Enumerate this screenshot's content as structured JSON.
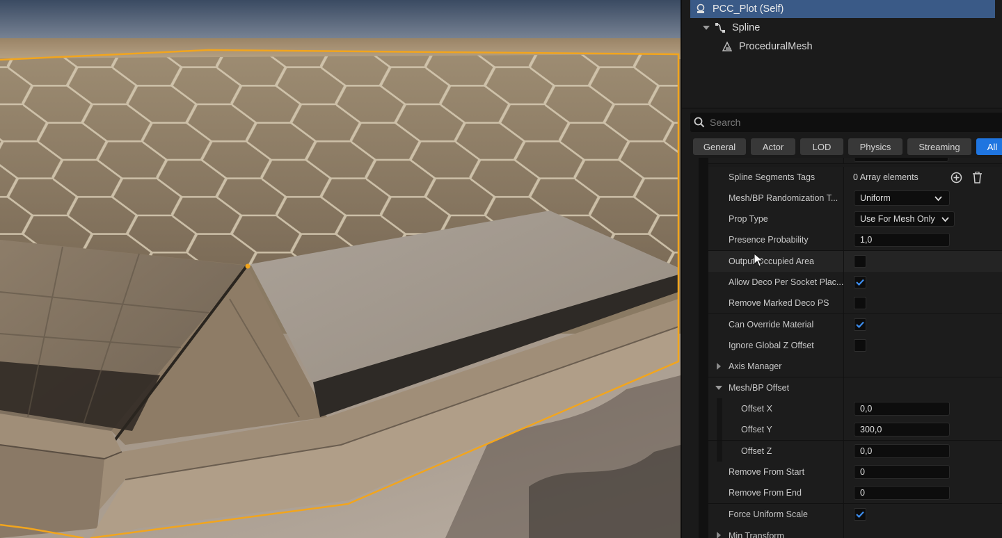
{
  "outliner": {
    "self_label": "PCC_Plot (Self)",
    "spline_label": "Spline",
    "mesh_label": "ProceduralMesh"
  },
  "search": {
    "placeholder": "Search"
  },
  "tabs": [
    {
      "label": "General",
      "active": false
    },
    {
      "label": "Actor",
      "active": false
    },
    {
      "label": "LOD",
      "active": false
    },
    {
      "label": "Physics",
      "active": false
    },
    {
      "label": "Streaming",
      "active": false
    },
    {
      "label": "All",
      "active": true
    }
  ],
  "properties": {
    "spline_segments_tags": {
      "label": "Spline Segments Tags",
      "value": "0 Array elements"
    },
    "randomization": {
      "label": "Mesh/BP Randomization T...",
      "value": "Uniform"
    },
    "prop_type": {
      "label": "Prop Type",
      "value": "Use For Mesh Only"
    },
    "presence_probability": {
      "label": "Presence Probability",
      "value": "1,0"
    },
    "output_occupied_area": {
      "label": "Output Occupied Area",
      "checked": false
    },
    "allow_deco": {
      "label": "Allow Deco Per Socket Plac...",
      "checked": true
    },
    "remove_marked_deco": {
      "label": "Remove Marked Deco PS",
      "checked": false
    },
    "can_override_material": {
      "label": "Can Override Material",
      "checked": true
    },
    "ignore_global_z": {
      "label": "Ignore Global Z Offset",
      "checked": false
    },
    "axis_manager": {
      "label": "Axis Manager"
    },
    "mesh_bp_offset": {
      "label": "Mesh/BP Offset"
    },
    "offset_x": {
      "label": "Offset X",
      "value": "0,0"
    },
    "offset_y": {
      "label": "Offset Y",
      "value": "300,0"
    },
    "offset_z": {
      "label": "Offset Z",
      "value": "0,0"
    },
    "remove_from_start": {
      "label": "Remove From Start",
      "value": "0"
    },
    "remove_from_end": {
      "label": "Remove From End",
      "value": "0"
    },
    "force_uniform_scale": {
      "label": "Force Uniform Scale",
      "checked": true
    },
    "min_transform": {
      "label": "Min Transform"
    }
  },
  "colors": {
    "accent": "#1f75e0",
    "selection": "#3a5a87",
    "outline": "#f2a51d"
  },
  "icons": {
    "self": "actor-blueprint-icon",
    "spline": "spline-icon",
    "mesh": "procedural-mesh-icon",
    "search": "search-icon",
    "add": "add-element-icon",
    "delete": "trash-icon",
    "dropdown": "chevron-down-icon",
    "check": "checkmark-icon",
    "cursor": "mouse-cursor-icon"
  }
}
